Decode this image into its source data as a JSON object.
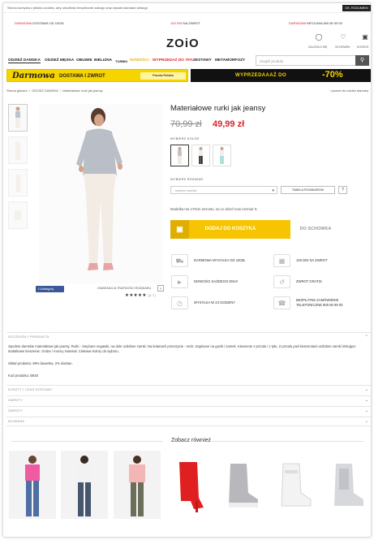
{
  "cookie": {
    "text": "Strona korzysta z plików cookies, aby umożliwić bezpieczne zakupy oraz wysoki standard obsługi.",
    "button": "OK, ROZUMIEM"
  },
  "promos": {
    "left_highlight": "DARMOWA",
    "left_rest": " DOSTAWA OD 100ZŁ",
    "center_highlight": "100 DNI",
    "center_rest": " NA ZWROT",
    "right_highlight": "DARMOWA",
    "right_rest": " INFOLINIA 800 80 99 00"
  },
  "logo": "ZOiO",
  "header_icons": {
    "login": "ZALOGUJ SIĘ",
    "wishlist": "SCHOWEK",
    "cart": "KOSZYK"
  },
  "nav": [
    {
      "label": "ODZIEŻ DAMSKA"
    },
    {
      "label": "ODZIEŻ MĘSKA"
    },
    {
      "label": "OBUWIE"
    },
    {
      "label": "BIELIZNA"
    },
    {
      "label": "TORBKI"
    },
    {
      "label": "NOWOŚCI"
    },
    {
      "label": "WYPRZEDAŻ DO 70%"
    },
    {
      "label": "ZESTAWY"
    },
    {
      "label": "METAMORFOZY"
    }
  ],
  "search": {
    "placeholder": "Znajdź produkt"
  },
  "banners": {
    "left_script": "Darmowa",
    "left_bold": "DOSTAWA I ZWROT",
    "left_partner": "Poczta Polska",
    "right_text": "WYPRZEDAAAŻ DO",
    "right_percent": "-70%"
  },
  "breadcrumb": {
    "home": "Strona główna",
    "cat": "ODZIEŻ DAMSKA",
    "current": "Materiałowe rurki jak jeansy",
    "sep": "/",
    "back": "‹ powrót do odzież damska"
  },
  "product": {
    "title": "Materiałowe rurki jak jeansy",
    "old_price": "70,99 zł",
    "new_price": "49,99 zł",
    "color_label": "WYBIERZ KOLOR",
    "size_label": "WYBIERZ ROZMIAR",
    "size_placeholder": "wybierz rozmiar",
    "size_table": "TABELA ROZMIARÓW",
    "size_help": "?",
    "model_note": "Modelka ma 170cm wzrostu, na co dzień nosi rozmiar S.",
    "add_to_cart": "DODAJ DO KOSZYKA",
    "to_wishlist": "DO SCHOWKA"
  },
  "features": [
    {
      "label": "DARMOWA WYSYŁKA OD 100ZŁ",
      "icon": "truck-icon"
    },
    {
      "label": "100 DNI NA ZWROT",
      "icon": "calendar-icon"
    },
    {
      "label": "NOWOŚCI KAŻDEGO DNIA!",
      "icon": "megaphone-icon"
    },
    {
      "label": "ZWROT GRATIS",
      "icon": "return-arrow-icon"
    },
    {
      "label": "WYSYŁKA W 24 GODZINY",
      "icon": "clock-icon"
    },
    {
      "label": "BEZPŁATNE ZAMÓWIENIE",
      "label2": "TELEFONICZNE 800 80 99 00",
      "icon": "phone-icon"
    }
  ],
  "social": {
    "fb": "Udostępnij",
    "guarantee": "GWARANCJA TRAFNOŚCI ROZMIARU",
    "rating_count": "(4.7)",
    "stars": "★★★★★"
  },
  "sections": [
    {
      "title": "SZCZEGÓŁY PRODUKTU",
      "chevron": "^"
    },
    {
      "title": "KOSZTY I CZAS DOSTAWY",
      "chevron": "v"
    },
    {
      "title": "ZWROTY",
      "chevron": "v"
    },
    {
      "title": "ZWROTY",
      "chevron": "v"
    },
    {
      "title": "WYMIANA",
      "chevron": "v"
    }
  ],
  "details": {
    "line1": "Spodnie damskie materiałowe jak jeansy. Rurki - zwężane nogawki, na dole ozdobne zamki. Na kolanach przeszycie - wzór. Zapinane na guzik i zamek. Kieszenie z przodu i z tyłu. Z przodu pod kieszeniami ozdobne zamki imitujące",
    "line2": "dodatkowe kieszenie. Grube i mocny materiał. Ciekawe kolory do wyboru.",
    "composition": "Skład produktu: 98% bawełna, 2% elastan.",
    "code": "Kod produktu: B920"
  },
  "recommend_title": "Zobacz również",
  "colors": {
    "accent": "#d8232a",
    "yellow": "#f6c400",
    "dark": "#111111"
  }
}
